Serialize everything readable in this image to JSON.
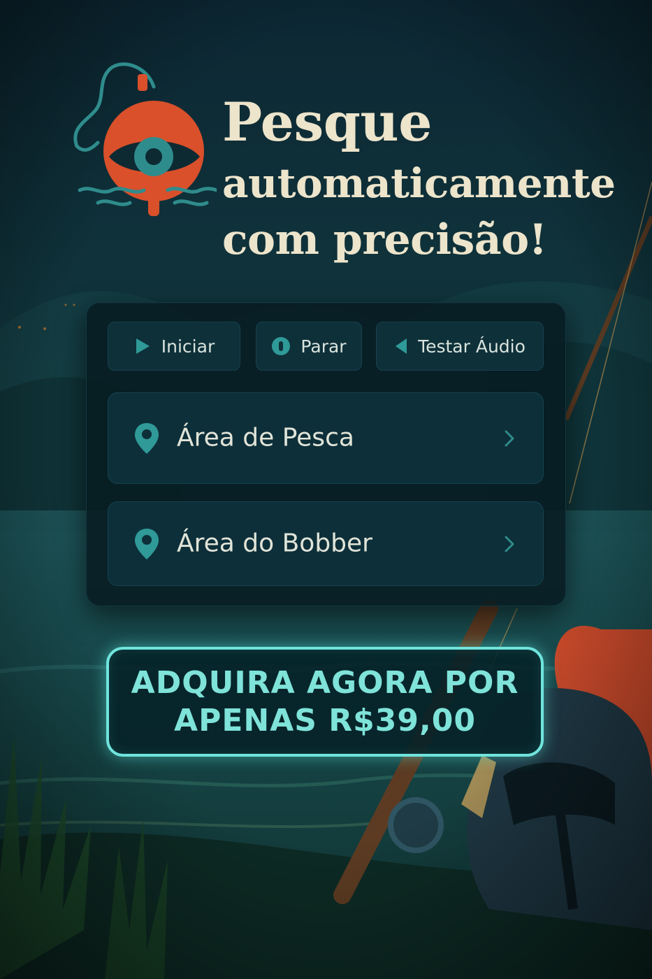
{
  "header": {
    "logo_icon": "bobber-eye-icon",
    "title_line1": "Pesque",
    "title_line2": "automaticamente",
    "title_line3": "com precisão!"
  },
  "controls": {
    "start_label": "Iniciar",
    "stop_label": "Parar",
    "audio_label": "Testar Áudio",
    "start_icon": "play-icon",
    "stop_icon": "stop-icon",
    "audio_icon": "speaker-icon"
  },
  "areas": [
    {
      "label": "Área de Pesca",
      "icon": "location-pin-icon"
    },
    {
      "label": "Área do Bobber",
      "icon": "location-pin-icon"
    }
  ],
  "cta": {
    "line1": "ADQUIRA AGORA POR",
    "line2": "APENAS R$39,00"
  },
  "colors": {
    "background": "#0d2a33",
    "accent_teal": "#2f8c8c",
    "accent_orange": "#d9502b",
    "cta_glow": "#6fe4dc",
    "headline": "#ece4cb"
  }
}
